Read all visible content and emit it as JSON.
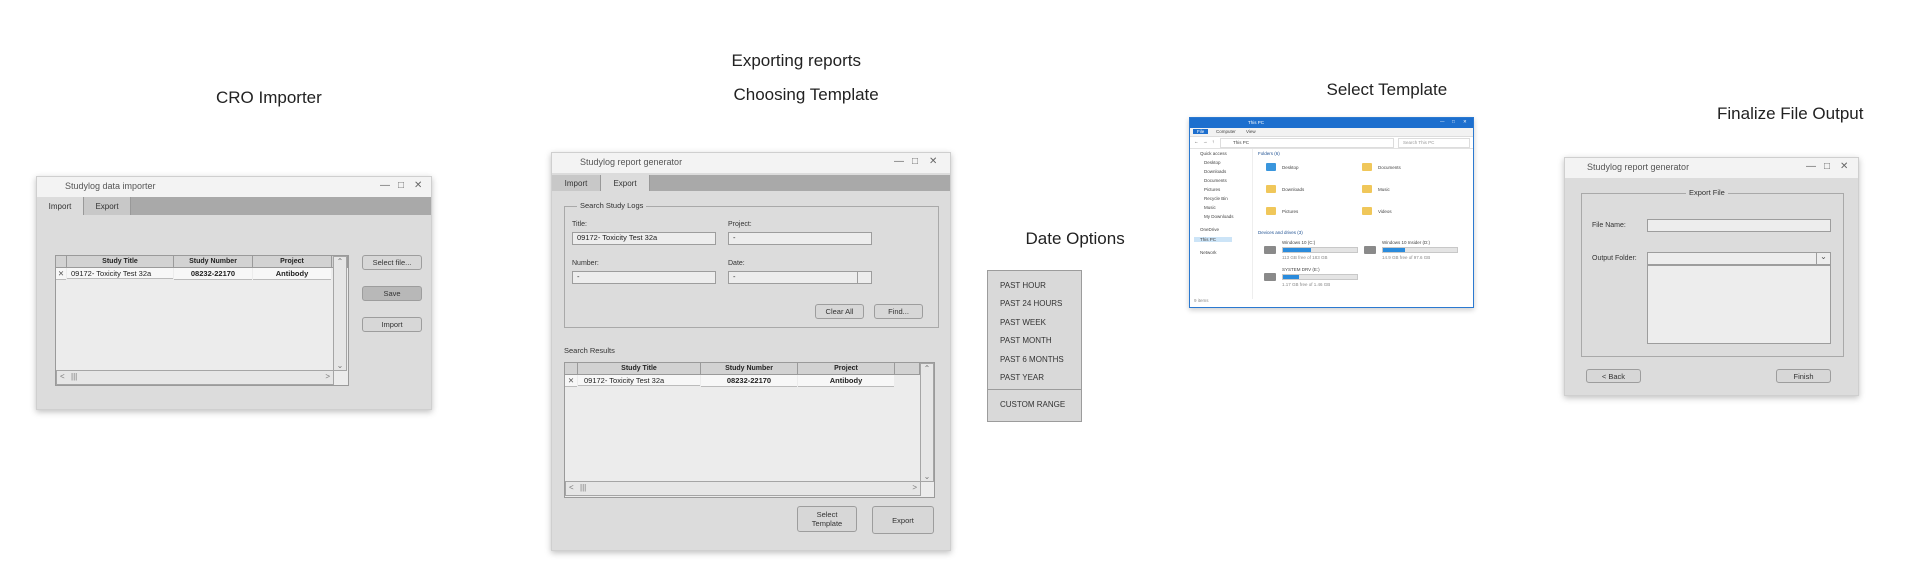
{
  "headings": {
    "cro": "CRO Importer",
    "exporting": "Exporting reports",
    "choosing": "Choosing Template",
    "date_options": "Date Options",
    "select_template": "Select Template",
    "finalize": "Finalize File Output"
  },
  "importer": {
    "title": "Studylog data importer",
    "tabs": [
      "Import",
      "Export"
    ],
    "columns": [
      "Study Title",
      "Study Number",
      "Project"
    ],
    "rows": [
      {
        "title": "09172- Toxicity Test 32a",
        "number": "08232-22170",
        "project": "Antibody"
      }
    ],
    "buttons": {
      "select_file": "Select file...",
      "save": "Save",
      "import": "Import"
    }
  },
  "generator": {
    "title": "Studylog report generator",
    "tabs": [
      "Import",
      "Export"
    ],
    "search_group": "Search Study Logs",
    "labels": {
      "title": "Title:",
      "project": "Project:",
      "number": "Number:",
      "date": "Date:"
    },
    "values": {
      "title": "09172- Toxicity Test 32a",
      "project": "-",
      "number": "-",
      "date": "-"
    },
    "buttons": {
      "clear_all": "Clear All",
      "find": "Find...",
      "select_template": "Select Template",
      "export": "Export"
    },
    "results_label": "Search Results",
    "columns": [
      "Study Title",
      "Study Number",
      "Project"
    ],
    "rows": [
      {
        "title": "09172- Toxicity Test 32a",
        "number": "08232-22170",
        "project": "Antibody"
      }
    ]
  },
  "date_menu": {
    "items": [
      "PAST HOUR",
      "PAST 24 HOURS",
      "PAST WEEK",
      "PAST MONTH",
      "PAST 6 MONTHS",
      "PAST YEAR"
    ],
    "custom": "CUSTOM RANGE"
  },
  "explorer": {
    "title": "This PC",
    "ribbon_tabs": [
      "File",
      "Computer",
      "View"
    ],
    "address": "This PC",
    "search_placeholder": "Search This PC",
    "nav": [
      "Quick access",
      "Desktop",
      "Downloads",
      "Documents",
      "Pictures",
      "Recycle Bin",
      "Music",
      "My Downloads",
      "OneDrive",
      "This PC",
      "Network"
    ],
    "folders_header": "Folders (6)",
    "folders": [
      "Desktop",
      "Documents",
      "Downloads",
      "Music",
      "Pictures",
      "Videos"
    ],
    "devices_header": "Devices and drives (3)",
    "drives": [
      {
        "name": "Windows 10 (C:)",
        "free": "113 GB free of 183 GB",
        "used_fraction": 0.38
      },
      {
        "name": "Windows 10 Insider (D:)",
        "free": "14.9 GB free of 97.6 GB",
        "used_fraction": 0.3
      },
      {
        "name": "SYSTEM DRV (E:)",
        "free": "1.17 GB free of 1.46 GB",
        "used_fraction": 0.22
      }
    ],
    "status": "9 items"
  },
  "finalize": {
    "title": "Studylog report generator",
    "group": "Export File",
    "file_name_label": "File Name:",
    "output_folder_label": "Output Folder:",
    "buttons": {
      "back": "< Back",
      "finish": "Finish"
    }
  },
  "colors": {
    "explorer_accent": "#1d6fce",
    "window_bg": "#dcdcdc",
    "tabstrip": "#a9a9a9"
  }
}
